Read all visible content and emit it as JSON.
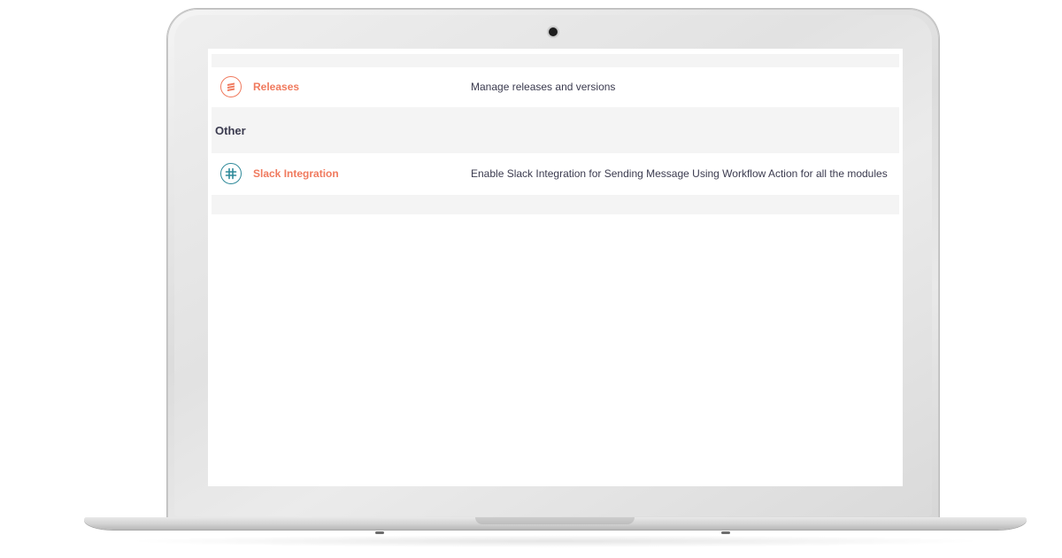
{
  "colors": {
    "accent": "#f07a5e",
    "text": "#3b3b4f",
    "band": "#f4f4f4",
    "releases_icon": "#f07a5e",
    "slack_icon": "#2f8a9a"
  },
  "modules": [
    {
      "name": "Releases",
      "description": "Manage releases and versions",
      "icon": "stack-layers-icon"
    }
  ],
  "sections": [
    {
      "title": "Other",
      "items": [
        {
          "name": "Slack Integration",
          "description": "Enable Slack Integration for Sending Message Using Workflow Action for all the modules",
          "icon": "slack-hash-icon"
        }
      ]
    }
  ]
}
